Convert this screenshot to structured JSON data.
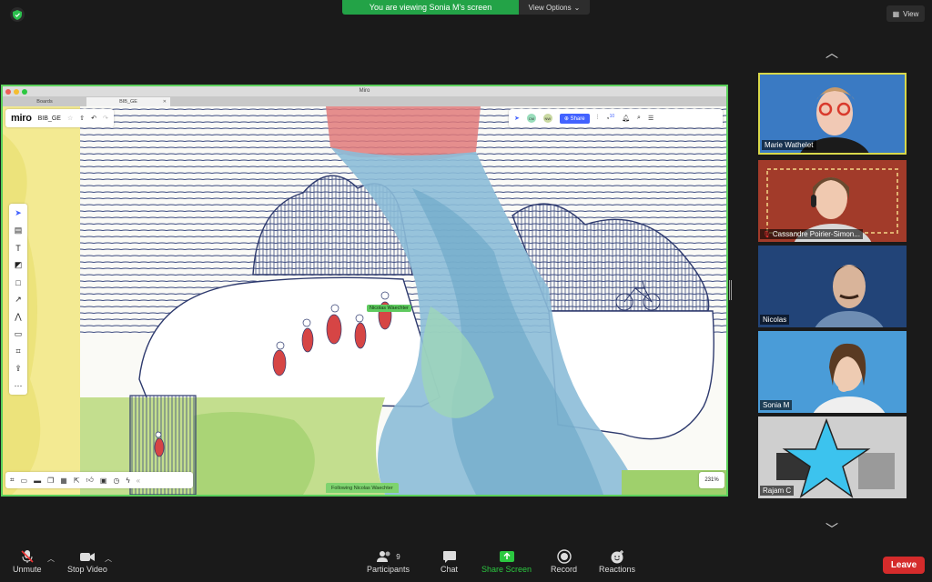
{
  "banner": {
    "message": "You are viewing Sonia M's screen",
    "view_options": "View Options"
  },
  "view_button": "View",
  "window": {
    "title": "Miro",
    "tabs": [
      {
        "label": "Boards",
        "active": false
      },
      {
        "label": "BIB_GE",
        "active": true
      }
    ]
  },
  "miro": {
    "logo": "miro",
    "board_name": "BIB_GE",
    "share_label": "Share",
    "avatars": [
      "CM",
      "NW"
    ],
    "notification_count": "10",
    "zoom": "231%",
    "following_label": "Following Nicolas Waechter",
    "cursor_label": "Nicolas Waechter",
    "left_tools": [
      "select-icon",
      "frame-template-icon",
      "text-icon",
      "sticky-note-icon",
      "shape-icon",
      "arrow-icon",
      "pen-icon",
      "comment-icon",
      "frame-icon",
      "upload-icon",
      "more-icon"
    ],
    "bottom_tools": [
      "frames-icon",
      "comment-icon",
      "chat-icon",
      "cards-icon",
      "kanban-icon",
      "share-screen-icon",
      "vote-icon",
      "video-icon",
      "timer-icon",
      "activity-icon",
      "collapse-icon"
    ]
  },
  "participants": [
    {
      "name": "Marie Wathelet",
      "active_speaker": true,
      "muted": false,
      "bg": "#2f6fb8"
    },
    {
      "name": "Cassandre Poirier-Simon...",
      "active_speaker": false,
      "muted": true,
      "bg": "#a23b2a"
    },
    {
      "name": "Nicolas",
      "active_speaker": false,
      "muted": false,
      "bg": "#1d3a66"
    },
    {
      "name": "Sonia M",
      "active_speaker": false,
      "muted": false,
      "bg": "#3b8fd0"
    },
    {
      "name": "Rajam C",
      "active_speaker": false,
      "muted": false,
      "bg": "#cfcfcf"
    }
  ],
  "controls": {
    "unmute": "Unmute",
    "stop_video": "Stop Video",
    "participants": "Participants",
    "participants_count": "9",
    "chat": "Chat",
    "share_screen": "Share Screen",
    "record": "Record",
    "reactions": "Reactions",
    "leave": "Leave"
  },
  "colors": {
    "accent_green": "#23a347",
    "leave_red": "#d52b2b",
    "share_border": "#5bd05b",
    "miro_blue": "#4262ff"
  }
}
